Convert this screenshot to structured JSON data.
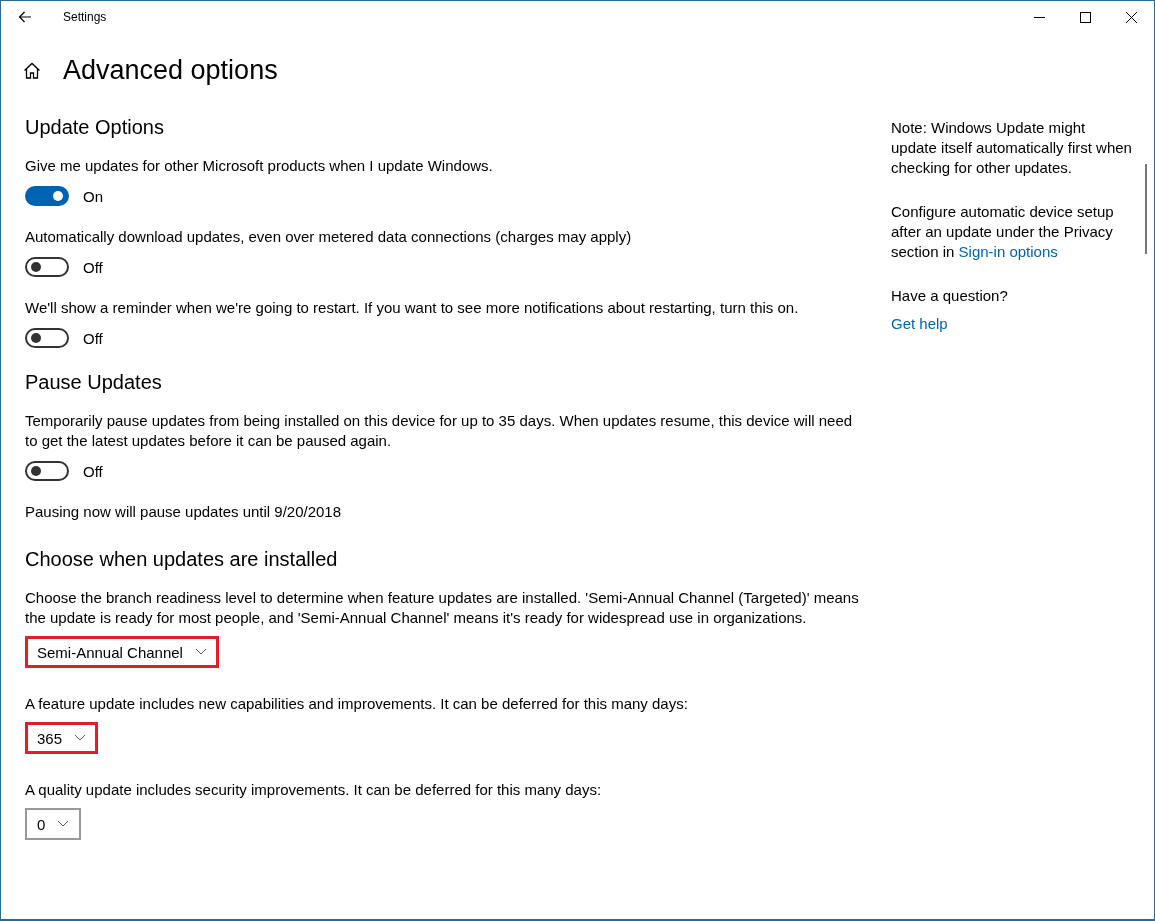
{
  "window": {
    "title": "Settings"
  },
  "page_title": "Advanced options",
  "sections": [
    {
      "heading": "Update Options",
      "items": [
        {
          "kind": "toggle",
          "label": "Give me updates for other Microsoft products when I update Windows.",
          "on": true,
          "state_text": "On"
        },
        {
          "kind": "toggle",
          "label": "Automatically download updates, even over metered data connections (charges may apply)",
          "on": false,
          "state_text": "Off"
        },
        {
          "kind": "toggle",
          "label": "We'll show a reminder when we're going to restart. If you want to see more notifications about restarting, turn this on.",
          "on": false,
          "state_text": "Off"
        }
      ]
    },
    {
      "heading": "Pause Updates",
      "items": [
        {
          "kind": "toggle",
          "label": "Temporarily pause updates from being installed on this device for up to 35 days. When updates resume, this device will need to get the latest updates before it can be paused again.",
          "on": false,
          "state_text": "Off"
        },
        {
          "kind": "text",
          "text": "Pausing now will pause updates until 9/20/2018"
        }
      ]
    },
    {
      "heading": "Choose when updates are installed",
      "items": [
        {
          "kind": "dropdown",
          "label": "Choose the branch readiness level to determine when feature updates are installed. 'Semi-Annual Channel (Targeted)' means the update is ready for most people, and 'Semi-Annual Channel' means it's ready for widespread use in organizations.",
          "value": "Semi-Annual Channel",
          "highlighted": true
        },
        {
          "kind": "dropdown",
          "label": "A feature update includes new capabilities and improvements. It can be deferred for this many days:",
          "value": "365",
          "highlighted": true
        },
        {
          "kind": "dropdown",
          "label": "A quality update includes security improvements. It can be deferred for this many days:",
          "value": "0",
          "highlighted": false
        }
      ]
    }
  ],
  "sidebar": [
    {
      "kind": "text",
      "text": "Note: Windows Update might update itself automatically first when checking for other updates."
    },
    {
      "kind": "text_with_link",
      "text": "Configure automatic device setup after an update under the Privacy section in ",
      "link": "Sign-in options"
    },
    {
      "kind": "text",
      "text": "Have a question?"
    },
    {
      "kind": "link",
      "text": "Get help"
    }
  ]
}
